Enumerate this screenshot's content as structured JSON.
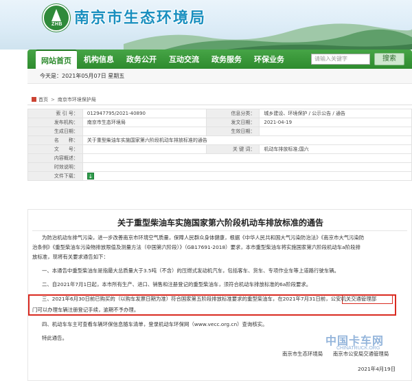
{
  "site": {
    "name": "南京市生态环境局",
    "logo_text": "ZHB"
  },
  "nav": {
    "items": [
      "网站首页",
      "机构信息",
      "政务公开",
      "互动交流",
      "政务服务",
      "环保业务"
    ],
    "search_placeholder": "请输入关键字",
    "search_button": "搜索"
  },
  "today": "今天是：2021年05月07日 星期五",
  "breadcrumb": [
    "首页",
    "南京市环境保护局"
  ],
  "meta": {
    "rows": [
      {
        "l1": "索 引 号：",
        "v1": "012947795/2021-40890",
        "l2": "信息分类：",
        "v2": "城乡建设、环境保护 / 公示公告 / 通告"
      },
      {
        "l1": "发布机构：",
        "v1": "南京市生态环境局",
        "l2": "发文日期：",
        "v2": "2021-04-19"
      },
      {
        "l1": "生成日期：",
        "v1": "",
        "l2": "生效日期：",
        "v2": ""
      },
      {
        "l1": "名　　称：",
        "v1": "关于重型柴油车实施国家第六阶段机动车排放标准的通告",
        "l2": "",
        "v2": ""
      },
      {
        "l1": "文　　号：",
        "v1": "",
        "l2": "关 键 词：",
        "v2": "机动车排放标准;国六"
      },
      {
        "l1": "内容概述：",
        "v1": "",
        "l2": "",
        "v2": ""
      },
      {
        "l1": "时效说明：",
        "v1": "",
        "l2": "",
        "v2": ""
      },
      {
        "l1": "文件下载：",
        "v1": "",
        "l2": "",
        "v2": ""
      }
    ]
  },
  "article": {
    "title": "关于重型柴油车实施国家第六阶段机动车排放标准的通告",
    "p1": [
      "为防治机动车排气污染，进一步改善南京市环境空气质量，保障人民群众身体健康，根据《中华人民共和国大气污染防治法》《南京市大气污染防",
      "治条例》《重型柴油车污染物排放限值及测量方法（中国第六阶段）》（GB17691-2018）要求，本市重型柴油车将实施国家第六阶段机动车a阶段排",
      "放标准，现将有关要求通告如下："
    ],
    "p2": "一、本通告中重型柴油车是指最大总质量大于3.5吨（不含）的压燃式发动机汽车，包括客车、货车、专项作业车等上道路行驶车辆。",
    "p3": "二、自2021年7月1日起，本市所有生产、进口、销售和注册登记的重型柴油车，须符合机动车排放标准的6a阶段要求。",
    "p4a": "三、2021年6月30日前已购买的（以购车发票日期为准）符合国家第五阶段排放标准要求的重型柴油车，在2021年7月31日前，公安机关交通管理部",
    "p4b": "门可以办理车辆注册登记手续，逾期不予办理。",
    "p5": "四、机动车车主可查看车辆环保信息随车清单，登录机动车环保网（www.vecc.org.cn）查询核实。",
    "p6": "特此通告。",
    "signature": "南京市生态环境局　　南京市公安局交通管理局",
    "sign_date": "2021年4月19日"
  },
  "watermark": {
    "cn": "中国卡车网",
    "en": "CHINATRUCK.ORG"
  },
  "colors": {
    "nav_green": "#2e8b2e",
    "title_blue": "#1a8fbf",
    "highlight_red": "#d92a20"
  }
}
